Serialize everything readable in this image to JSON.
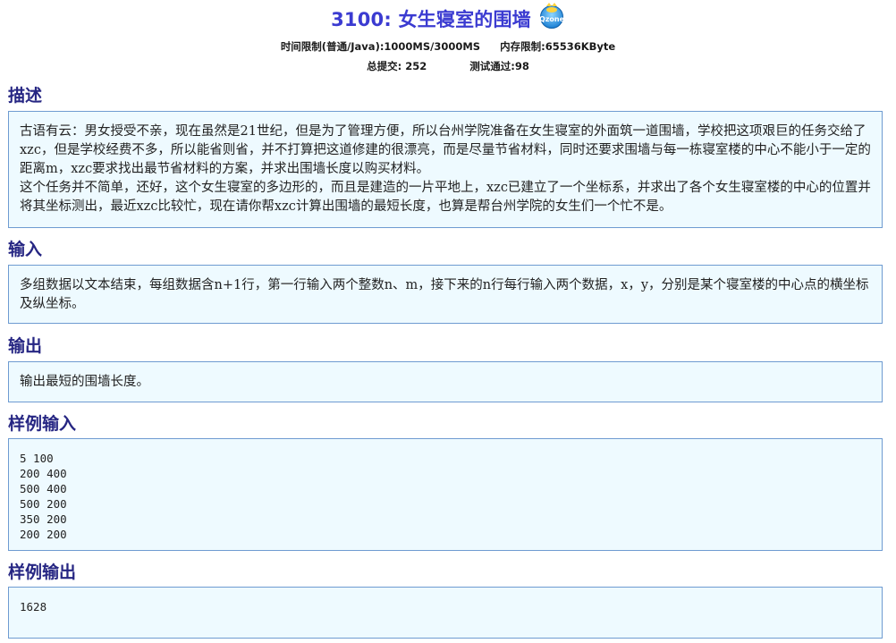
{
  "problem": {
    "title": "3100: 女生寝室的围墙",
    "time_limit": "时间限制(普通/Java):1000MS/3000MS",
    "memory_limit": "内存限制:65536KByte",
    "total_submit": "总提交: 252",
    "accepted": "测试通过:98",
    "qzone_icon": "qzone-share-icon",
    "qzone_text": "Qzone"
  },
  "sections": {
    "description": {
      "heading": "描述",
      "text": "古语有云：男女授受不亲，现在虽然是21世纪，但是为了管理方便，所以台州学院准备在女生寝室的外面筑一道围墙，学校把这项艰巨的任务交给了xzc，但是学校经费不多，所以能省则省，并不打算把这道修建的很漂亮，而是尽量节省材料，同时还要求围墙与每一栋寝室楼的中心不能小于一定的距离m，xzc要求找出最节省材料的方案，并求出围墙长度以购买材料。\n这个任务并不简单，还好，这个女生寝室的多边形的，而且是建造的一片平地上，xzc已建立了一个坐标系，并求出了各个女生寝室楼的中心的位置并将其坐标测出，最近xzc比较忙，现在请你帮xzc计算出围墙的最短长度，也算是帮台州学院的女生们一个忙不是。"
    },
    "input": {
      "heading": "输入",
      "text": "多组数据以文本结束，每组数据含n+1行，第一行输入两个整数n、m，接下来的n行每行输入两个数据，x，y，分别是某个寝室楼的中心点的横坐标及纵坐标。"
    },
    "output": {
      "heading": "输出",
      "text": "输出最短的围墙长度。"
    },
    "sample_input": {
      "heading": "样例输入",
      "text": "5 100\n200 400\n500 400\n500 200\n350 200\n200 200"
    },
    "sample_output": {
      "heading": "样例输出",
      "text": "1628"
    }
  }
}
